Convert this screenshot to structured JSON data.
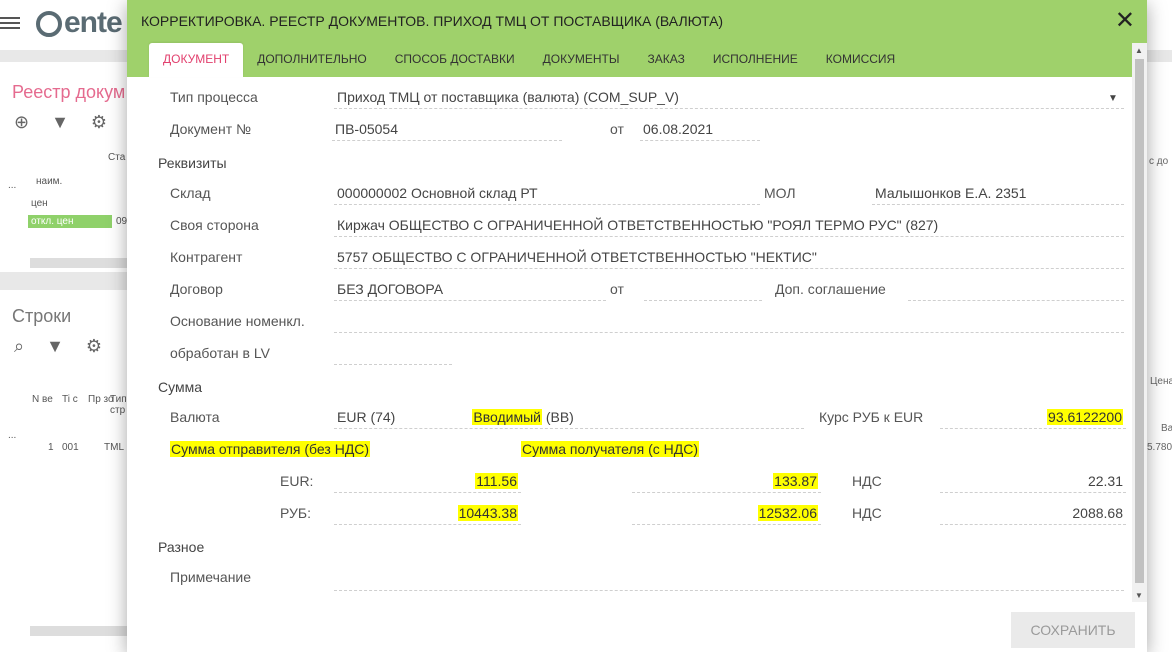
{
  "background": {
    "registry_title": "Реестр докум",
    "lines_title": "Строки",
    "col_state": "Ста",
    "col_name": "наим.",
    "row_price": "цен",
    "row_price_off": "откл. цен",
    "row_price_off_num": "09",
    "lines_headers": [
      "N ве",
      "Ti с",
      "Пр зо",
      "Тип стр"
    ],
    "lines_row": [
      "1",
      "001",
      "TML"
    ],
    "right_labels": [
      "с до",
      "Цена",
      "Ва",
      "5.780"
    ],
    "ellipsis": "..."
  },
  "dialog": {
    "title": "КОРРЕКТИРОВКА. РЕЕСТР ДОКУМЕНТОВ. ПРИХОД ТМЦ ОТ ПОСТАВЩИКА (ВАЛЮТА)",
    "close": "✕",
    "tabs": [
      "ДОКУМЕНТ",
      "ДОПОЛНИТЕЛЬНО",
      "СПОСОБ ДОСТАВКИ",
      "ДОКУМЕНТЫ",
      "ЗАКАЗ",
      "ИСПОЛНЕНИЕ",
      "КОМИССИЯ"
    ],
    "active_tab": "ДОКУМЕНТ",
    "form": {
      "process_type_label": "Тип процесса",
      "process_type_value": "Приход ТМЦ от поставщика (валюта) (COM_SUP_V)",
      "doc_no_label": "Документ №",
      "doc_no_value": "ПВ-05054",
      "from_label": "от",
      "doc_date": "06.08.2021",
      "requisites_section": "Реквизиты",
      "warehouse_label": "Склад",
      "warehouse_value": "000000002 Основной склад РТ",
      "mol_label": "МОЛ",
      "mol_value": "Малышонков Е.А.   2351",
      "own_side_label": "Своя сторона",
      "own_side_value": "Киржач ОБЩЕСТВО С ОГРАНИЧЕННОЙ ОТВЕТСТВЕННОСТЬЮ \"РОЯЛ ТЕРМО РУС\" (827)",
      "counterparty_label": "Контрагент",
      "counterparty_value": "5757 ОБЩЕСТВО С ОГРАНИЧЕННОЙ ОТВЕТСТВЕННОСТЬЮ \"НЕКТИС\"",
      "contract_label": "Договор",
      "contract_value": "БЕЗ ДОГОВОРА",
      "contract_from_label": "от",
      "addendum_label": "Доп. соглашение",
      "basis_label": "Основание номенкл.",
      "processed_lv_label": "обработан в LV",
      "sum_section": "Сумма",
      "currency_label": "Валюта",
      "currency_value": "EUR (74)",
      "entered_hl": "Вводимый",
      "entered_rest": " (ВВ)",
      "rate_label": "Курс РУБ к EUR",
      "rate_value": "93.6122200",
      "sender_sum_label": "Сумма отправителя (без НДС)",
      "receiver_sum_label": "Сумма получателя (с НДС)",
      "eur_label": "EUR:",
      "eur_sender": "111.56",
      "eur_receiver": "133.87",
      "vat_label": "НДС",
      "eur_vat": "22.31",
      "rub_label": "РУБ:",
      "rub_sender": "10443.38",
      "rub_receiver": "12532.06",
      "rub_vat": "2088.68",
      "misc_section": "Разное",
      "note_label": "Примечание"
    },
    "save_button": "СОХРАНИТЬ"
  },
  "colors": {
    "header_green": "#9fd16b",
    "active_tab_text": "#e2406e",
    "highlight": "#ffff00"
  }
}
